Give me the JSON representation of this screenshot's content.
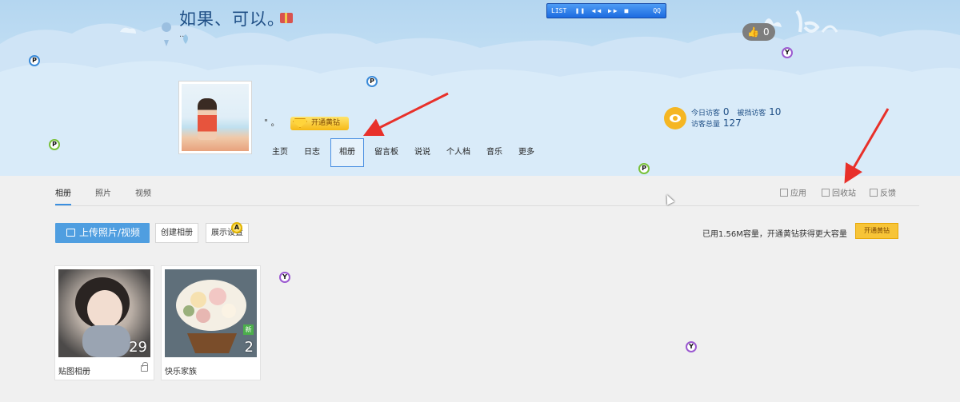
{
  "header": {
    "title": "如果、可以。",
    "subtitle": "..",
    "nickname": "\" 。",
    "vip_label": "开通黄钻",
    "like_count": "0",
    "music_player": {
      "label": "LIST",
      "qq": "QQ"
    }
  },
  "nav": [
    {
      "label": "主页",
      "active": false
    },
    {
      "label": "日志",
      "active": false
    },
    {
      "label": "相册",
      "active": true
    },
    {
      "label": "留言板",
      "active": false
    },
    {
      "label": "说说",
      "active": false
    },
    {
      "label": "个人档",
      "active": false
    },
    {
      "label": "音乐",
      "active": false
    },
    {
      "label": "更多",
      "active": false
    }
  ],
  "visitors": {
    "today_label": "今日访客",
    "today_value": "0",
    "blocked_label": "被挡访客",
    "blocked_value": "10",
    "total_label": "访客总量",
    "total_value": "127"
  },
  "tabs": {
    "album": "相册",
    "photos": "照片",
    "videos": "视频"
  },
  "tools": {
    "apps": "应用",
    "recycle": "回收站",
    "feedback": "反馈"
  },
  "actions": {
    "upload": "上传照片/视频",
    "create_album": "创建相册",
    "display_settings": "展示设置"
  },
  "quota": {
    "text": "已用1.56M容量，开通黄钻获得更大容量",
    "vip_button": "开通黄钻"
  },
  "albums": [
    {
      "name": "贴图相册",
      "count": "29",
      "locked": true,
      "is_new": false
    },
    {
      "name": "快乐家族",
      "count": "2",
      "locked": false,
      "is_new": true,
      "new_label": "新"
    }
  ],
  "colors": {
    "accent": "#4f9ee0",
    "title": "#1f4f86",
    "annotation_arrow": "#e8302a",
    "vip_gold": "#f7c437"
  }
}
